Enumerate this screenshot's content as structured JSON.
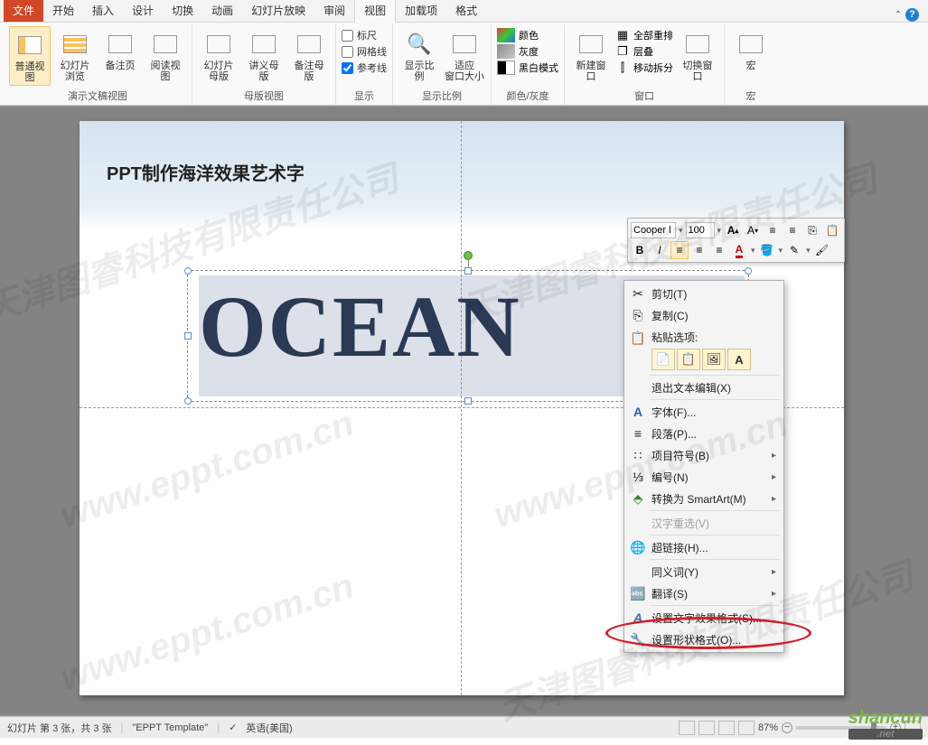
{
  "tabs": {
    "file": "文件",
    "home": "开始",
    "insert": "插入",
    "design": "设计",
    "transitions": "切换",
    "animations": "动画",
    "slideshow": "幻灯片放映",
    "review": "审阅",
    "view": "视图",
    "addins": "加载项",
    "format": "格式"
  },
  "ribbon": {
    "group_presentation": "演示文稿视图",
    "group_master": "母版视图",
    "group_show": "显示",
    "group_zoom": "显示比例",
    "group_color": "颜色/灰度",
    "group_window": "窗口",
    "group_macros": "宏",
    "btn_normal": "普通视图",
    "btn_sorter": "幻灯片浏览",
    "btn_notes": "备注页",
    "btn_reading": "阅读视图",
    "btn_slidemaster": "幻灯片母版",
    "btn_handoutmaster": "讲义母版",
    "btn_notesmaster": "备注母版",
    "chk_ruler": "标尺",
    "chk_gridlines": "网格线",
    "chk_guides": "参考线",
    "btn_zoom": "显示比例",
    "btn_fit": "适应\n窗口大小",
    "btn_color": "颜色",
    "btn_gray": "灰度",
    "btn_bw": "黑白模式",
    "btn_newwindow": "新建窗口",
    "btn_arrange": "全部重排",
    "btn_cascade": "层叠",
    "btn_split": "移动拆分",
    "btn_switch": "切换窗口",
    "btn_macros": "宏"
  },
  "slide": {
    "title": "PPT制作海洋效果艺术字",
    "wordart": "OCEAN"
  },
  "mini_toolbar": {
    "font": "Cooper l",
    "size": "100"
  },
  "context_menu": {
    "cut": "剪切(T)",
    "copy": "复制(C)",
    "paste_label": "粘贴选项:",
    "exit_edit": "退出文本编辑(X)",
    "font": "字体(F)...",
    "paragraph": "段落(P)...",
    "bullets": "项目符号(B)",
    "numbering": "编号(N)",
    "smartart": "转换为 SmartArt(M)",
    "hanzi": "汉字重选(V)",
    "hyperlink": "超链接(H)...",
    "thesaurus": "同义词(Y)",
    "translate": "翻译(S)",
    "text_effects": "设置文字效果格式(S)...",
    "shape_format": "设置形状格式(O)..."
  },
  "status": {
    "slide_info": "幻灯片 第 3 张，共 3 张",
    "template": "\"EPPT Template\"",
    "language": "英语(美国)",
    "zoom": "87%"
  },
  "watermarks": {
    "url": "www.eppt.com.cn",
    "cn": "天津图睿科技有限责任公司",
    "logo": "shancun",
    "net": ".net"
  }
}
